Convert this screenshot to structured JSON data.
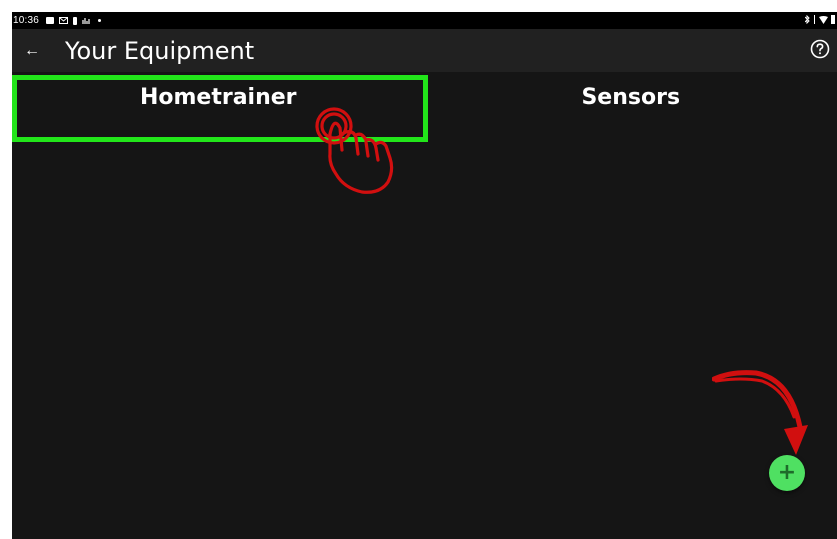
{
  "status_bar": {
    "time": "10:36",
    "left_icons": [
      "photo-icon",
      "mail-icon",
      "battery-saver-icon",
      "vpn-icon",
      "dot-icon"
    ],
    "right_icons": [
      "bluetooth-icon",
      "signal-icon",
      "wifi-icon",
      "battery-icon"
    ]
  },
  "app_bar": {
    "back_icon": "←",
    "title": "Your Equipment",
    "help_icon": "help-circle-icon"
  },
  "tabs": [
    {
      "label": "Hometrainer",
      "active": true
    },
    {
      "label": "Sensors",
      "active": false
    }
  ],
  "fab": {
    "label": "+",
    "color": "#4fe062"
  },
  "annotations": {
    "highlight_color": "#22e51a",
    "hand_color": "#d10f0f",
    "arrow_color": "#d10f0f"
  }
}
